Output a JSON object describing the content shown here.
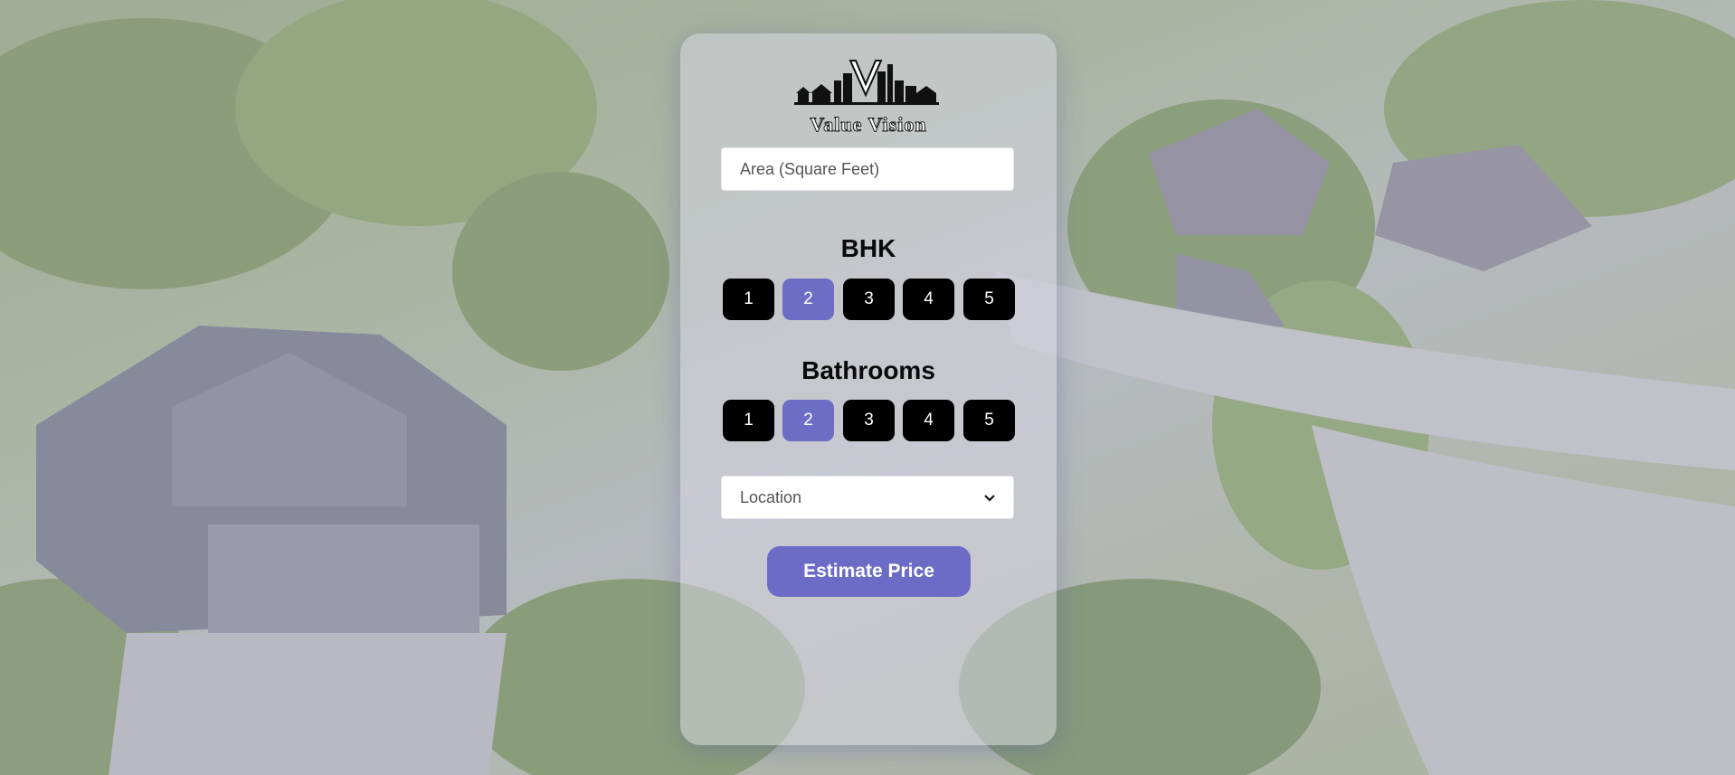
{
  "brand": {
    "name": "Value Vision",
    "accent_color": "#6c6cc7"
  },
  "form": {
    "area_placeholder": "Area (Square Feet)",
    "bhk": {
      "title": "BHK",
      "options": [
        "1",
        "2",
        "3",
        "4",
        "5"
      ],
      "selected": "2"
    },
    "bathrooms": {
      "title": "Bathrooms",
      "options": [
        "1",
        "2",
        "3",
        "4",
        "5"
      ],
      "selected": "2"
    },
    "location": {
      "selected_label": "Location"
    },
    "submit_label": "Estimate Price"
  },
  "icons": {
    "logo": "value-vision-logo",
    "location_dropdown": "chevron-down-icon"
  }
}
